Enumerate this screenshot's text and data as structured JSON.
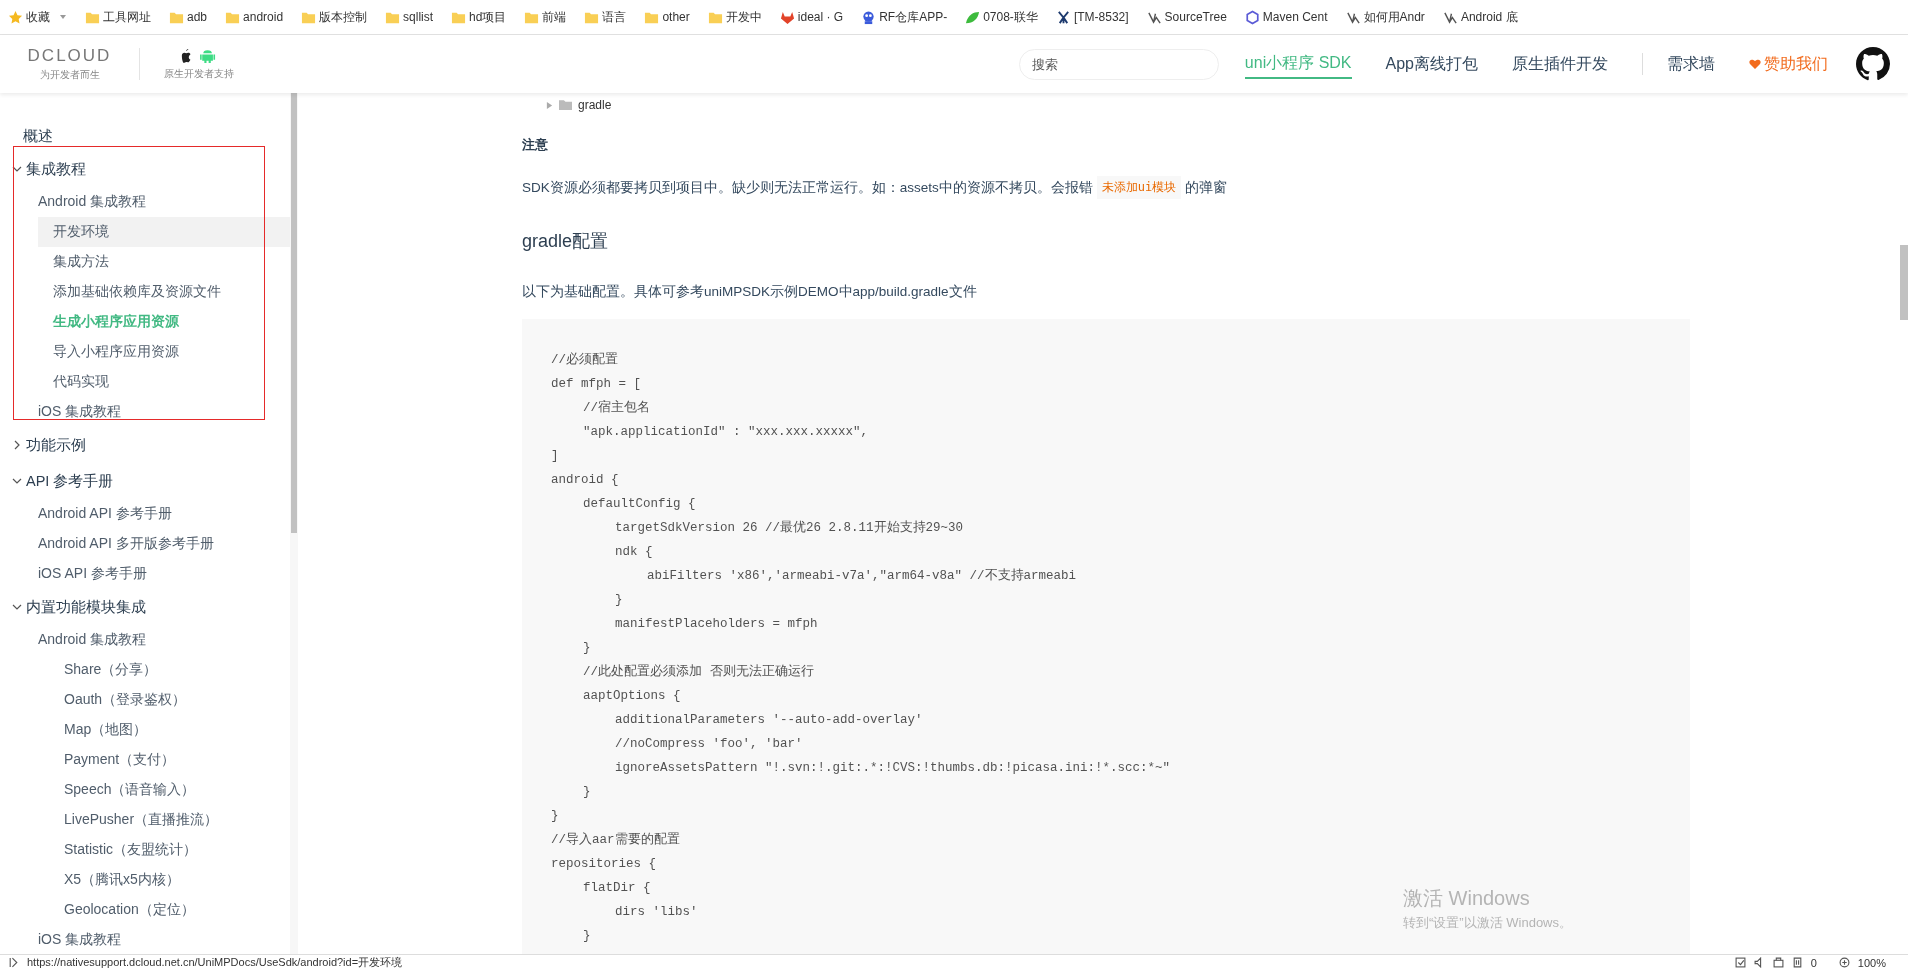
{
  "bookmarks": [
    {
      "label": "收藏",
      "kind": "star"
    },
    {
      "label": "工具网址",
      "kind": "folder"
    },
    {
      "label": "adb",
      "kind": "folder"
    },
    {
      "label": "android",
      "kind": "folder"
    },
    {
      "label": "版本控制",
      "kind": "folder"
    },
    {
      "label": "sqllist",
      "kind": "folder"
    },
    {
      "label": "hd项目",
      "kind": "folder"
    },
    {
      "label": "前端",
      "kind": "folder"
    },
    {
      "label": "语言",
      "kind": "folder"
    },
    {
      "label": "other",
      "kind": "folder"
    },
    {
      "label": "开发中",
      "kind": "folder"
    },
    {
      "label": "ideal · G",
      "kind": "fox"
    },
    {
      "label": "RF仓库APP-",
      "kind": "bot"
    },
    {
      "label": "0708-联华",
      "kind": "leaf"
    },
    {
      "label": "[TM-8532]",
      "kind": "jira"
    },
    {
      "label": "SourceTree",
      "kind": "tree"
    },
    {
      "label": "Maven Cent",
      "kind": "hexagon"
    },
    {
      "label": "如何用Andr",
      "kind": "tree"
    },
    {
      "label": "Android 底",
      "kind": "tree"
    }
  ],
  "header": {
    "logo": "DCLOUD",
    "slogan": "为开发者而生",
    "platform_caption": "原生开发者支持",
    "search": {
      "placeholder": "搜索"
    },
    "nav": [
      {
        "label": "uni小程序 SDK",
        "selected": true
      },
      {
        "label": "App离线打包",
        "selected": false
      },
      {
        "label": "原生插件开发",
        "selected": false
      }
    ],
    "wall_link": "需求墙",
    "sponsor_link": "赞助我们"
  },
  "sidebar": {
    "items": [
      {
        "label": "概述"
      },
      {
        "label": "集成教程",
        "expanded": true,
        "children": [
          {
            "label": "Android 集成教程",
            "children": [
              {
                "label": "开发环境",
                "selected": true,
                "current": false
              },
              {
                "label": "集成方法",
                "selected": false,
                "current": false
              },
              {
                "label": "添加基础依赖库及资源文件",
                "selected": false,
                "current": false
              },
              {
                "label": "生成小程序应用资源",
                "selected": false,
                "current": true
              },
              {
                "label": "导入小程序应用资源",
                "selected": false,
                "current": false
              },
              {
                "label": "代码实现",
                "selected": false,
                "current": false
              }
            ]
          },
          {
            "label": "iOS 集成教程"
          }
        ]
      },
      {
        "label": "功能示例",
        "expanded": false
      },
      {
        "label": "API 参考手册",
        "expanded": true,
        "children": [
          {
            "label": "Android API 参考手册"
          },
          {
            "label": "Android API 多开版参考手册"
          },
          {
            "label": "iOS API 参考手册"
          }
        ]
      },
      {
        "label": "内置功能模块集成",
        "expanded": true,
        "children": [
          {
            "label": "Android 集成教程",
            "children": [
              {
                "label": "Share（分享）"
              },
              {
                "label": "Oauth（登录鉴权）"
              },
              {
                "label": "Map（地图）"
              },
              {
                "label": "Payment（支付）"
              },
              {
                "label": "Speech（语音输入）"
              },
              {
                "label": "LivePusher（直播推流）"
              },
              {
                "label": "Statistic（友盟统计）"
              },
              {
                "label": "X5（腾讯x5内核）"
              },
              {
                "label": "Geolocation（定位）"
              }
            ]
          },
          {
            "label": "iOS 集成教程"
          }
        ]
      }
    ]
  },
  "content": {
    "tree_item": "gradle",
    "note_heading": "注意",
    "note_text": "SDK资源必须都要拷贝到项目中。缺少则无法正常运行。如：assets中的资源不拷贝。会报错",
    "note_code": "未添加ui模块",
    "note_suffix": "的弹窗",
    "heading": "gradle配置",
    "paragraph": "以下为基础配置。具体可参考uniMPSDK示例DEMO中app/build.gradle文件",
    "code": [
      {
        "text": "//必须配置"
      },
      {
        "text": "def mfph = [",
        "children": [
          {
            "text": "//宿主包名"
          },
          {
            "text": "\"apk.applicationId\" : \"xxx.xxx.xxxxx\","
          }
        ]
      },
      {
        "text": "]"
      },
      {
        "text": "android {",
        "children": [
          {
            "text": "defaultConfig {",
            "children": [
              {
                "text": "targetSdkVersion 26 //最优26 2.8.11开始支持29~30"
              },
              {
                "text": "ndk {",
                "children": [
                  {
                    "text": "abiFilters 'x86','armeabi-v7a',\"arm64-v8a\" //不支持armeabi"
                  }
                ]
              },
              {
                "text": "}"
              },
              {
                "text": "manifestPlaceholders = mfph"
              }
            ]
          },
          {
            "text": "}"
          },
          {
            "text": "//此处配置必须添加 否则无法正确运行"
          },
          {
            "text": "aaptOptions {",
            "children": [
              {
                "text": "additionalParameters '--auto-add-overlay'"
              },
              {
                "text": "//noCompress 'foo', 'bar'"
              },
              {
                "text": "ignoreAssetsPattern \"!.svn:!.git:.*:!CVS:!thumbs.db:!picasa.ini:!*.scc:*~\""
              }
            ]
          },
          {
            "text": "}"
          }
        ]
      },
      {
        "text": "}"
      },
      {
        "text": "//导入aar需要的配置"
      },
      {
        "text": "repositories {",
        "children": [
          {
            "text": "flatDir {",
            "children": [
              {
                "text": "dirs 'libs'"
              }
            ]
          },
          {
            "text": "}"
          }
        ]
      }
    ]
  },
  "windows_notice": {
    "title": "激活 Windows",
    "subtitle": "转到“设置”以激活 Windows。"
  },
  "status_bar": {
    "url": "https://nativesupport.dcloud.net.cn/UniMPDocs/UseSdk/android?id=开发环境",
    "count": "0",
    "zoom": "100%"
  }
}
